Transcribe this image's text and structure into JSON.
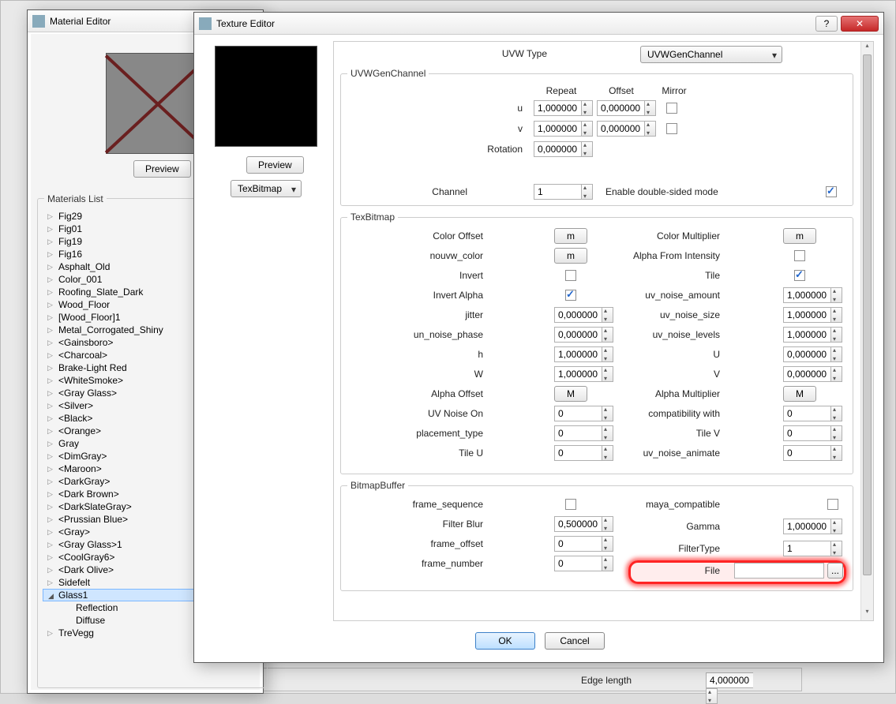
{
  "material_editor": {
    "title": "Material Editor",
    "preview_btn": "Preview",
    "list_title": "Materials List",
    "items": [
      "Fig29",
      "Fig01",
      "Fig19",
      "Fig16",
      "Asphalt_Old",
      "Color_001",
      "Roofing_Slate_Dark",
      "Wood_Floor",
      "[Wood_Floor]1",
      "Metal_Corrogated_Shiny",
      "<Gainsboro>",
      "<Charcoal>",
      "Brake-Light Red",
      "<WhiteSmoke>",
      "<Gray Glass>",
      "<Silver>",
      "<Black>",
      "<Orange>",
      "Gray",
      "<DimGray>",
      "<Maroon>",
      "<DarkGray>",
      "<Dark Brown>",
      "<DarkSlateGray>",
      "<Prussian Blue>",
      "<Gray>",
      "<Gray Glass>1",
      "<CoolGray6>",
      "<Dark Olive>",
      "Sidefelt"
    ],
    "selected": "Glass1",
    "children": [
      "Reflection",
      "Diffuse"
    ],
    "after": [
      "TreVegg"
    ]
  },
  "texture_editor": {
    "title": "Texture Editor",
    "preview_btn": "Preview",
    "combo": "TexBitmap",
    "uvw_type_label": "UVW Type",
    "uvw_type_value": "UVWGenChannel",
    "ok_btn": "OK",
    "cancel_btn": "Cancel"
  },
  "group_uvw": {
    "legend": "UVWGenChannel",
    "headers": {
      "repeat": "Repeat",
      "offset": "Offset",
      "mirror": "Mirror"
    },
    "rows": {
      "u": {
        "label": "u",
        "repeat": "1,000000",
        "offset": "0,000000"
      },
      "v": {
        "label": "v",
        "repeat": "1,000000",
        "offset": "0,000000"
      }
    },
    "rotation": {
      "label": "Rotation",
      "value": "0,000000"
    },
    "channel": {
      "label": "Channel",
      "value": "1"
    },
    "doublesided": {
      "label": "Enable double-sided mode",
      "checked": true
    }
  },
  "group_tex": {
    "legend": "TexBitmap",
    "left": {
      "color_offset": {
        "label": "Color Offset",
        "btn": "m"
      },
      "nouvw_color": {
        "label": "nouvw_color",
        "btn": "m"
      },
      "invert": {
        "label": "Invert",
        "checked": false
      },
      "invert_alpha": {
        "label": "Invert Alpha",
        "checked": true
      },
      "jitter": {
        "label": "jitter",
        "value": "0,000000"
      },
      "un_noise_phase": {
        "label": "un_noise_phase",
        "value": "0,000000"
      },
      "h": {
        "label": "h",
        "value": "1,000000"
      },
      "w": {
        "label": "W",
        "value": "1,000000"
      },
      "alpha_offset": {
        "label": "Alpha Offset",
        "btn": "M"
      },
      "uv_noise_on": {
        "label": "UV Noise On",
        "value": "0"
      },
      "placement_type": {
        "label": "placement_type",
        "value": "0"
      },
      "tile_u": {
        "label": "Tile U",
        "value": "0"
      }
    },
    "right": {
      "color_mult": {
        "label": "Color Multiplier",
        "btn": "m"
      },
      "alpha_from_int": {
        "label": "Alpha From Intensity",
        "checked": false
      },
      "tile": {
        "label": "Tile",
        "checked": true
      },
      "uv_noise_amount": {
        "label": "uv_noise_amount",
        "value": "1,000000"
      },
      "uv_noise_size": {
        "label": "uv_noise_size",
        "value": "1,000000"
      },
      "uv_noise_levels": {
        "label": "uv_noise_levels",
        "value": "1,000000"
      },
      "u": {
        "label": "U",
        "value": "0,000000"
      },
      "v": {
        "label": "V",
        "value": "0,000000"
      },
      "alpha_mult": {
        "label": "Alpha Multiplier",
        "btn": "M"
      },
      "compat": {
        "label": "compatibility with",
        "value": "0"
      },
      "tile_v": {
        "label": "Tile V",
        "value": "0"
      },
      "uv_noise_animate": {
        "label": "uv_noise_animate",
        "value": "0"
      }
    }
  },
  "group_bitmap": {
    "legend": "BitmapBuffer",
    "left": {
      "frame_sequence": {
        "label": "frame_sequence",
        "checked": false
      },
      "filter_blur": {
        "label": "Filter Blur",
        "value": "0,500000"
      },
      "frame_offset": {
        "label": "frame_offset",
        "value": "0"
      },
      "frame_number": {
        "label": "frame_number",
        "value": "0"
      }
    },
    "right": {
      "maya_compatible": {
        "label": "maya_compatible",
        "checked": false
      },
      "gamma": {
        "label": "Gamma",
        "value": "1,000000"
      },
      "filter_type": {
        "label": "FilterType",
        "value": "1"
      },
      "file": {
        "label": "File",
        "value": "",
        "browse": "..."
      }
    }
  },
  "bg": {
    "edge_length": {
      "label": "Edge length",
      "value": "4,000000"
    }
  }
}
